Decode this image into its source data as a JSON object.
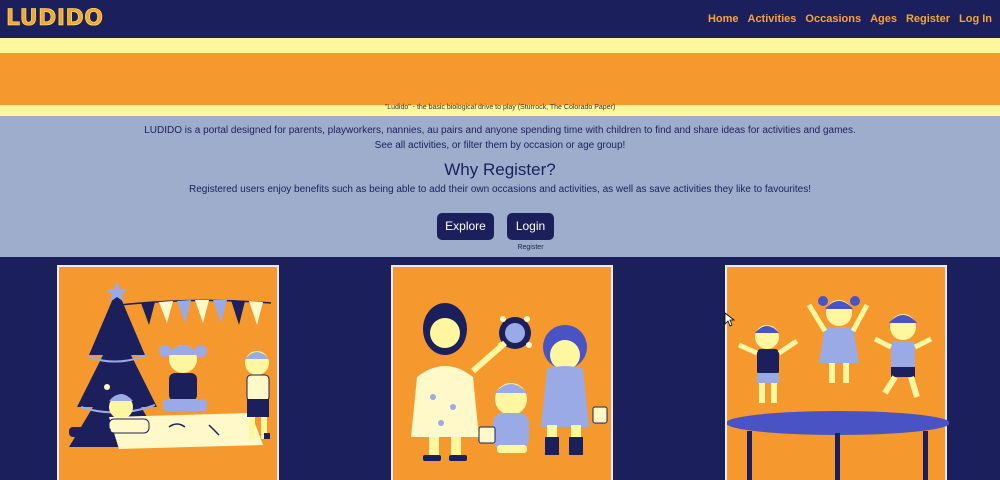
{
  "navbar": {
    "brand": "LUDIDO",
    "links": [
      "Home",
      "Activities",
      "Occasions",
      "Ages",
      "Register",
      "Log In"
    ]
  },
  "banner": {
    "quote": "\"Ludido\" - the basic biological drive to play (Sturrock, The Colorado Paper)"
  },
  "intro": {
    "line1": "LUDIDO is a portal designed for parents, playworkers, nannies, au pairs and anyone spending time with children to find and share ideas for activities and games.",
    "line2": "See all activities, or filter them by occasion or age group!",
    "heading": "Why Register?",
    "line3": "Registered users enjoy benefits such as being able to add their own occasions and activities, as well as save activities they like to favourites!",
    "explore_label": "Explore",
    "login_label": "Login",
    "register_label": "Register"
  },
  "colors": {
    "navy": "#1b1f5c",
    "orange": "#f5992f",
    "pale_yellow": "#fff59a",
    "slate": "#9fadcc"
  }
}
